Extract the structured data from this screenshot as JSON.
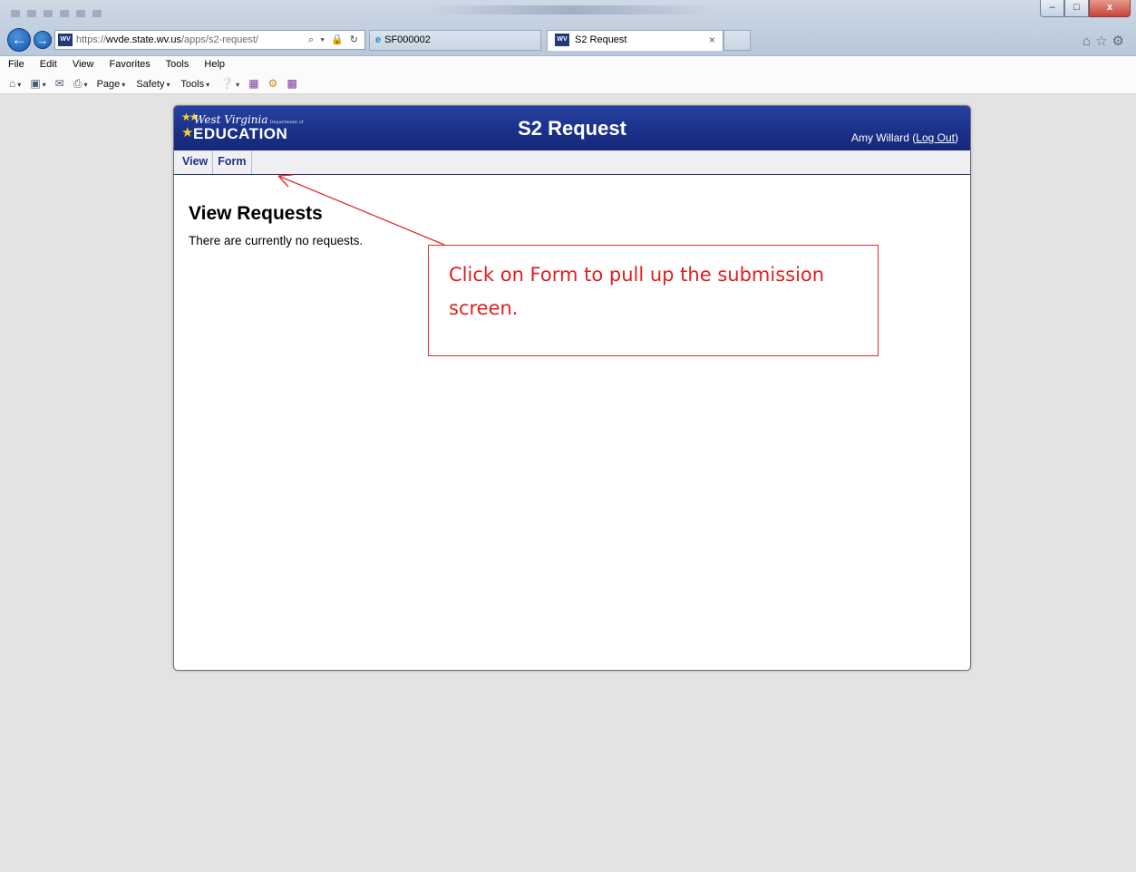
{
  "browser": {
    "url_prefix": "https://",
    "url_host": "wvde.state.wv.us",
    "url_path": "/apps/s2-request/",
    "addr_icons": "⌕ ▾ 🔒 ↻",
    "other_tab_label": "SF000002",
    "active_tab_label": "S2 Request",
    "tab_close": "×",
    "window_controls": {
      "minimize": "–",
      "maximize": "□",
      "close": "x"
    },
    "menu": [
      "File",
      "Edit",
      "View",
      "Favorites",
      "Tools",
      "Help"
    ],
    "command_bar": {
      "page": "Page",
      "safety": "Safety",
      "tools": "Tools"
    },
    "icons": [
      "home-icon",
      "feeds-icon",
      "mail-icon",
      "print-icon",
      "help-icon",
      "onenote-icon",
      "gear-icon",
      "addon-icon",
      "back-arrow-icon",
      "forward-arrow-icon",
      "star-icon"
    ]
  },
  "app": {
    "logo_script": "West Virginia",
    "logo_dept": "Department of",
    "logo_name": "EDUCATION",
    "title": "S2 Request",
    "user_name": "Amy Willard",
    "logout_open": " (",
    "logout_label": "Log Out",
    "logout_close": ")",
    "tabs": [
      "View",
      "Form"
    ],
    "page_heading": "View Requests",
    "empty_message": "There are currently no requests."
  },
  "annotation": {
    "text": "Click on Form to pull up the submission screen.",
    "color": "#e02020"
  },
  "colors": {
    "header_blue": "#1a3087",
    "tab_text": "#1d3185",
    "logo_gold": "#f7d229",
    "page_bg": "#e3e3e3"
  }
}
